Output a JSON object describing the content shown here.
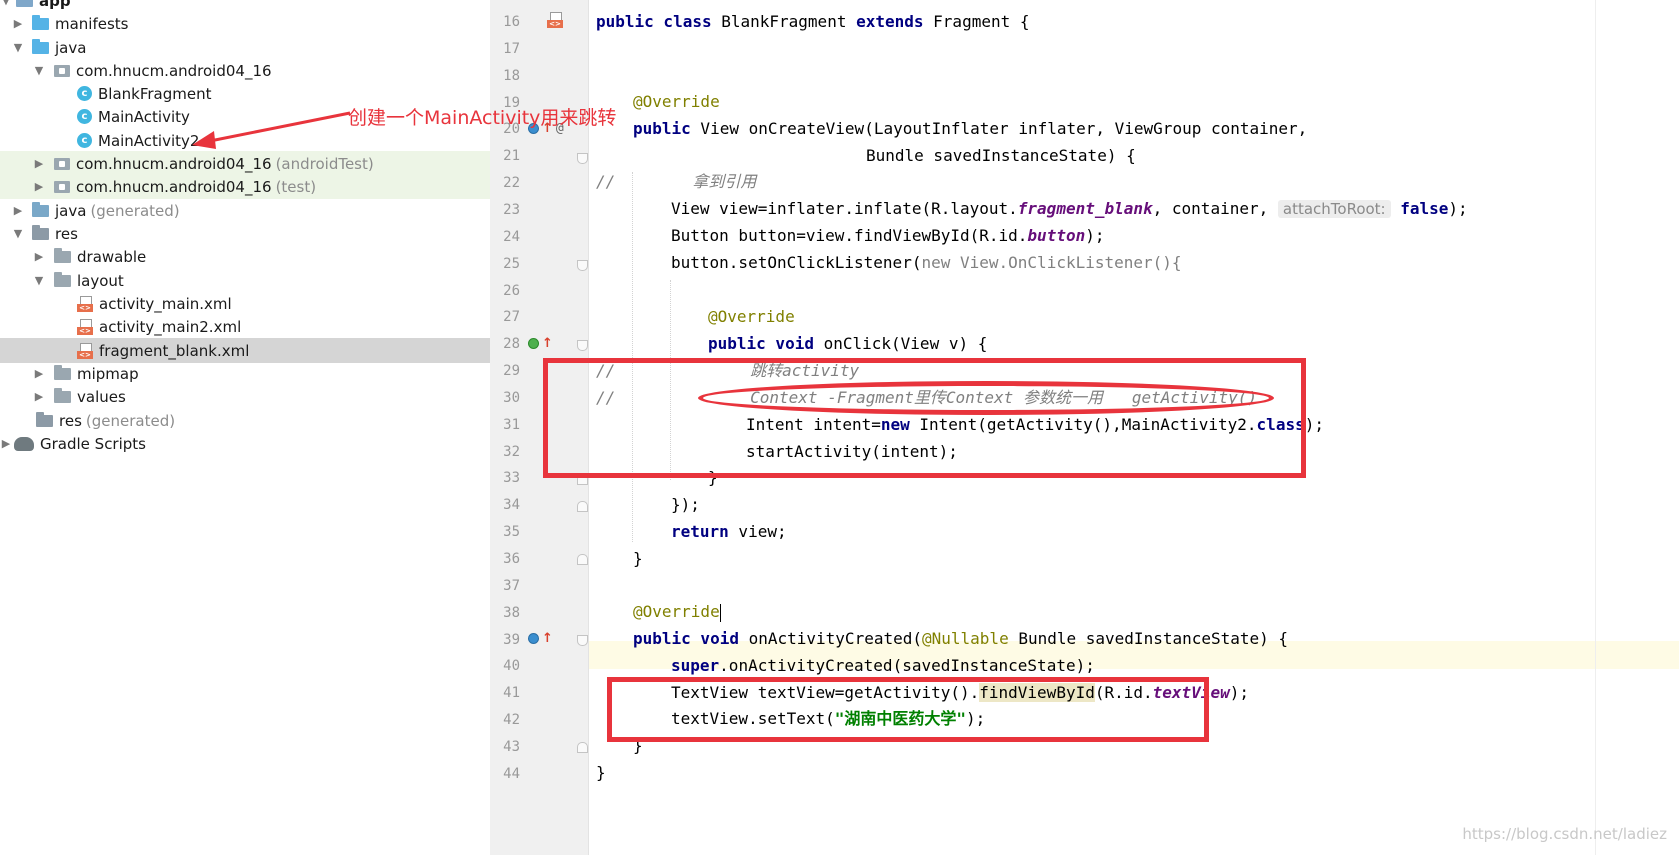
{
  "tree": {
    "root_label": "app",
    "rows": [
      {
        "label": "manifests",
        "suffix": ""
      },
      {
        "label": "java",
        "suffix": ""
      },
      {
        "label": "com.hnucm.android04_16",
        "suffix": ""
      },
      {
        "label": "BlankFragment",
        "suffix": ""
      },
      {
        "label": "MainActivity",
        "suffix": ""
      },
      {
        "label": "MainActivity2",
        "suffix": ""
      },
      {
        "label": "com.hnucm.android04_16",
        "suffix": "(androidTest)"
      },
      {
        "label": "com.hnucm.android04_16",
        "suffix": "(test)"
      },
      {
        "label": "java",
        "suffix": "(generated)"
      },
      {
        "label": "res",
        "suffix": ""
      },
      {
        "label": "drawable",
        "suffix": ""
      },
      {
        "label": "layout",
        "suffix": ""
      },
      {
        "label": "activity_main.xml",
        "suffix": ""
      },
      {
        "label": "activity_main2.xml",
        "suffix": ""
      },
      {
        "label": "fragment_blank.xml",
        "suffix": ""
      },
      {
        "label": "mipmap",
        "suffix": ""
      },
      {
        "label": "values",
        "suffix": ""
      },
      {
        "label": "res",
        "suffix": "(generated)"
      },
      {
        "label": "Gradle Scripts",
        "suffix": ""
      }
    ],
    "selected_index": 14
  },
  "annotation": {
    "callout_text": "创建一个MainActivity用来跳转"
  },
  "editor": {
    "line_numbers": [
      "16",
      "17",
      "18",
      "19",
      "20",
      "21",
      "22",
      "23",
      "24",
      "25",
      "26",
      "27",
      "28",
      "29",
      "30",
      "31",
      "32",
      "33",
      "34",
      "35",
      "36",
      "37",
      "38",
      "39",
      "40",
      "41",
      "42",
      "43",
      "44"
    ],
    "code": {
      "l16": {
        "kw1": "public class",
        "t1": " BlankFragment ",
        "kw2": "extends",
        "t2": " Fragment {"
      },
      "l19": {
        "ann": "@Override"
      },
      "l20": {
        "kw": "public",
        "t": " View onCreateView(LayoutInflater inflater, ViewGroup container,"
      },
      "l21": {
        "t": "Bundle savedInstanceState) {"
      },
      "l22": {
        "cm": "//        拿到引用"
      },
      "l23": {
        "t1": "View view=inflater.inflate(R.layout.",
        "fld": "fragment_blank",
        "t2": ", container, ",
        "hint": "attachToRoot:",
        "kw": "false",
        "t3": ");"
      },
      "l24": {
        "t1": "Button button=view.findViewById(R.id.",
        "fld": "button",
        "t2": ");"
      },
      "l25": {
        "t1": "button.setOnClickListener(",
        "kw": "new",
        "gr": " View.OnClickListener(){"
      },
      "l27": {
        "ann": "@Override"
      },
      "l28": {
        "kw": "public void",
        "t": " onClick(View v) {"
      },
      "l29": {
        "cm": "//              跳转activity"
      },
      "l30": {
        "cm": "//              Context -Fragment里传Context 参数统一用   getActivity()"
      },
      "l31": {
        "t1": "Intent intent=",
        "kw1": "new",
        "t2": " Intent(getActivity(),MainActivity2.",
        "kw2": "class",
        "t3": ");"
      },
      "l32": {
        "t": "startActivity(intent);"
      },
      "l33": {
        "t": "}"
      },
      "l34": {
        "t": "});"
      },
      "l35": {
        "kw": "return",
        "t": " view;"
      },
      "l36": {
        "t": "}"
      },
      "l38": {
        "ann": "@Override"
      },
      "l39": {
        "kw": "public void",
        "t1": " onActivityCreated(",
        "ann": "@Nullable",
        "t2": " Bundle savedInstanceState) {"
      },
      "l40": {
        "kw": "super",
        "t": ".onActivityCreated(savedInstanceState);"
      },
      "l41": {
        "t1": "TextView textView=getActivity().",
        "hl": "findViewById",
        "t2": "(R.id.",
        "fld": "textView",
        "t3": ");"
      },
      "l42": {
        "t1": "textView.setText(",
        "str": "\"湖南中医药大学\"",
        "t2": ");"
      },
      "l43": {
        "t": "}"
      },
      "l44": {
        "t": "}"
      }
    }
  },
  "watermark": "https://blog.csdn.net/ladiez",
  "colors": {
    "keyword": "#000080",
    "annotation": "#808000",
    "comment": "#808080",
    "field": "#660e7a",
    "string": "#008000",
    "markup": "#e8343c"
  }
}
